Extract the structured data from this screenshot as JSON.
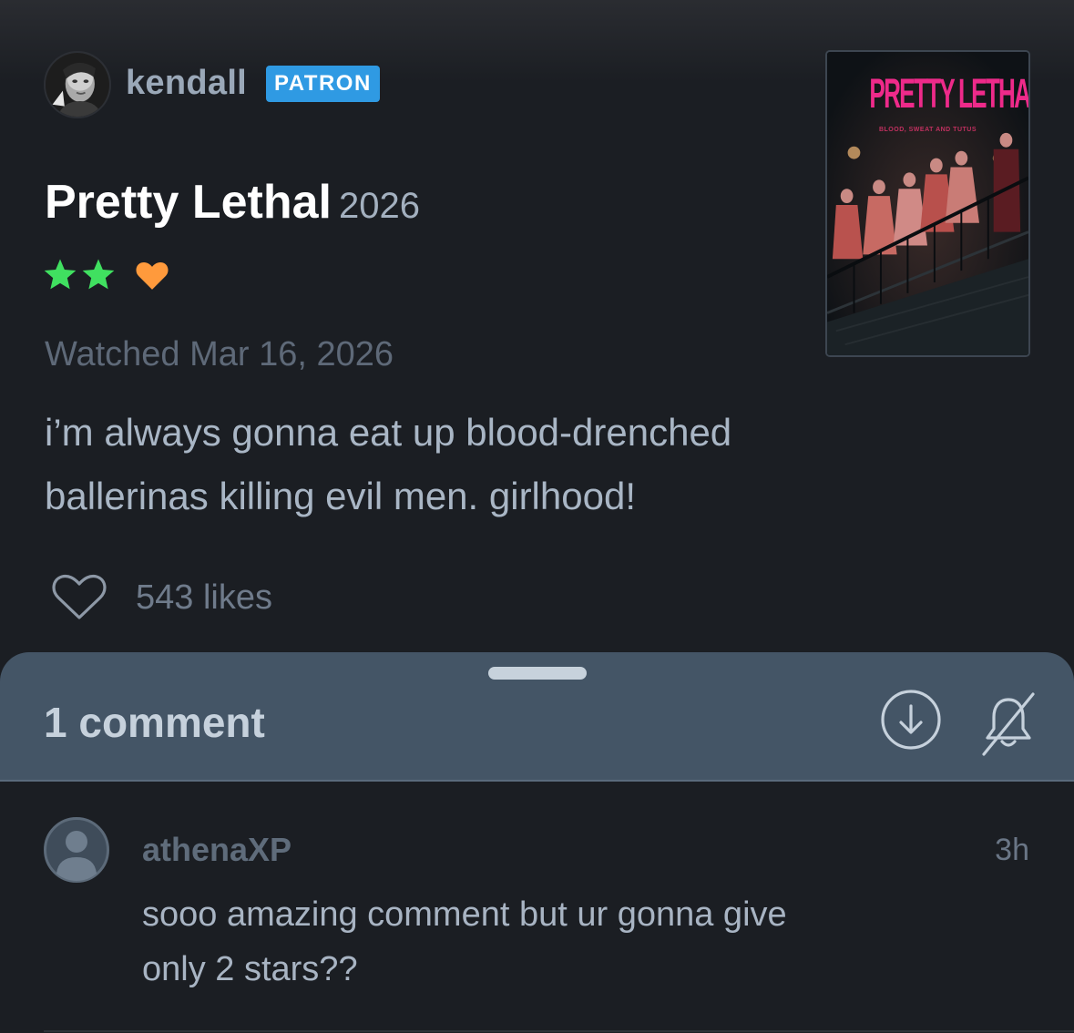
{
  "review": {
    "author": {
      "username": "kendall",
      "badge": "PATRON",
      "avatar_icon": "profile-photo"
    },
    "film": {
      "title": "Pretty Lethal",
      "year": "2026",
      "poster": {
        "title": "PRETTY LETHAL",
        "tagline": "BLOOD, SWEAT AND TUTUS"
      }
    },
    "rating": {
      "stars": 2,
      "max_stars": 5,
      "liked": true,
      "star_color": "#40e060",
      "heart_color": "#ff9a3c"
    },
    "watched_text": "Watched Mar 16, 2026",
    "body_lines": [
      "i’m always gonna eat up blood-drenched",
      "ballerinas killing evil men. girlhood!"
    ],
    "likes_text": "543 likes"
  },
  "comments_sheet": {
    "title": "1 comment",
    "actions": [
      "download-icon",
      "bell-off-icon"
    ],
    "comments": [
      {
        "username": "athenaXP",
        "time": "3h",
        "lines": [
          "sooo amazing comment but ur gonna give",
          "only 2 stars??"
        ]
      }
    ]
  },
  "colors": {
    "background": "#1b1e23",
    "sheet": "#445566",
    "badge": "#2f9ae3",
    "poster_title": "#ee2a8a"
  }
}
